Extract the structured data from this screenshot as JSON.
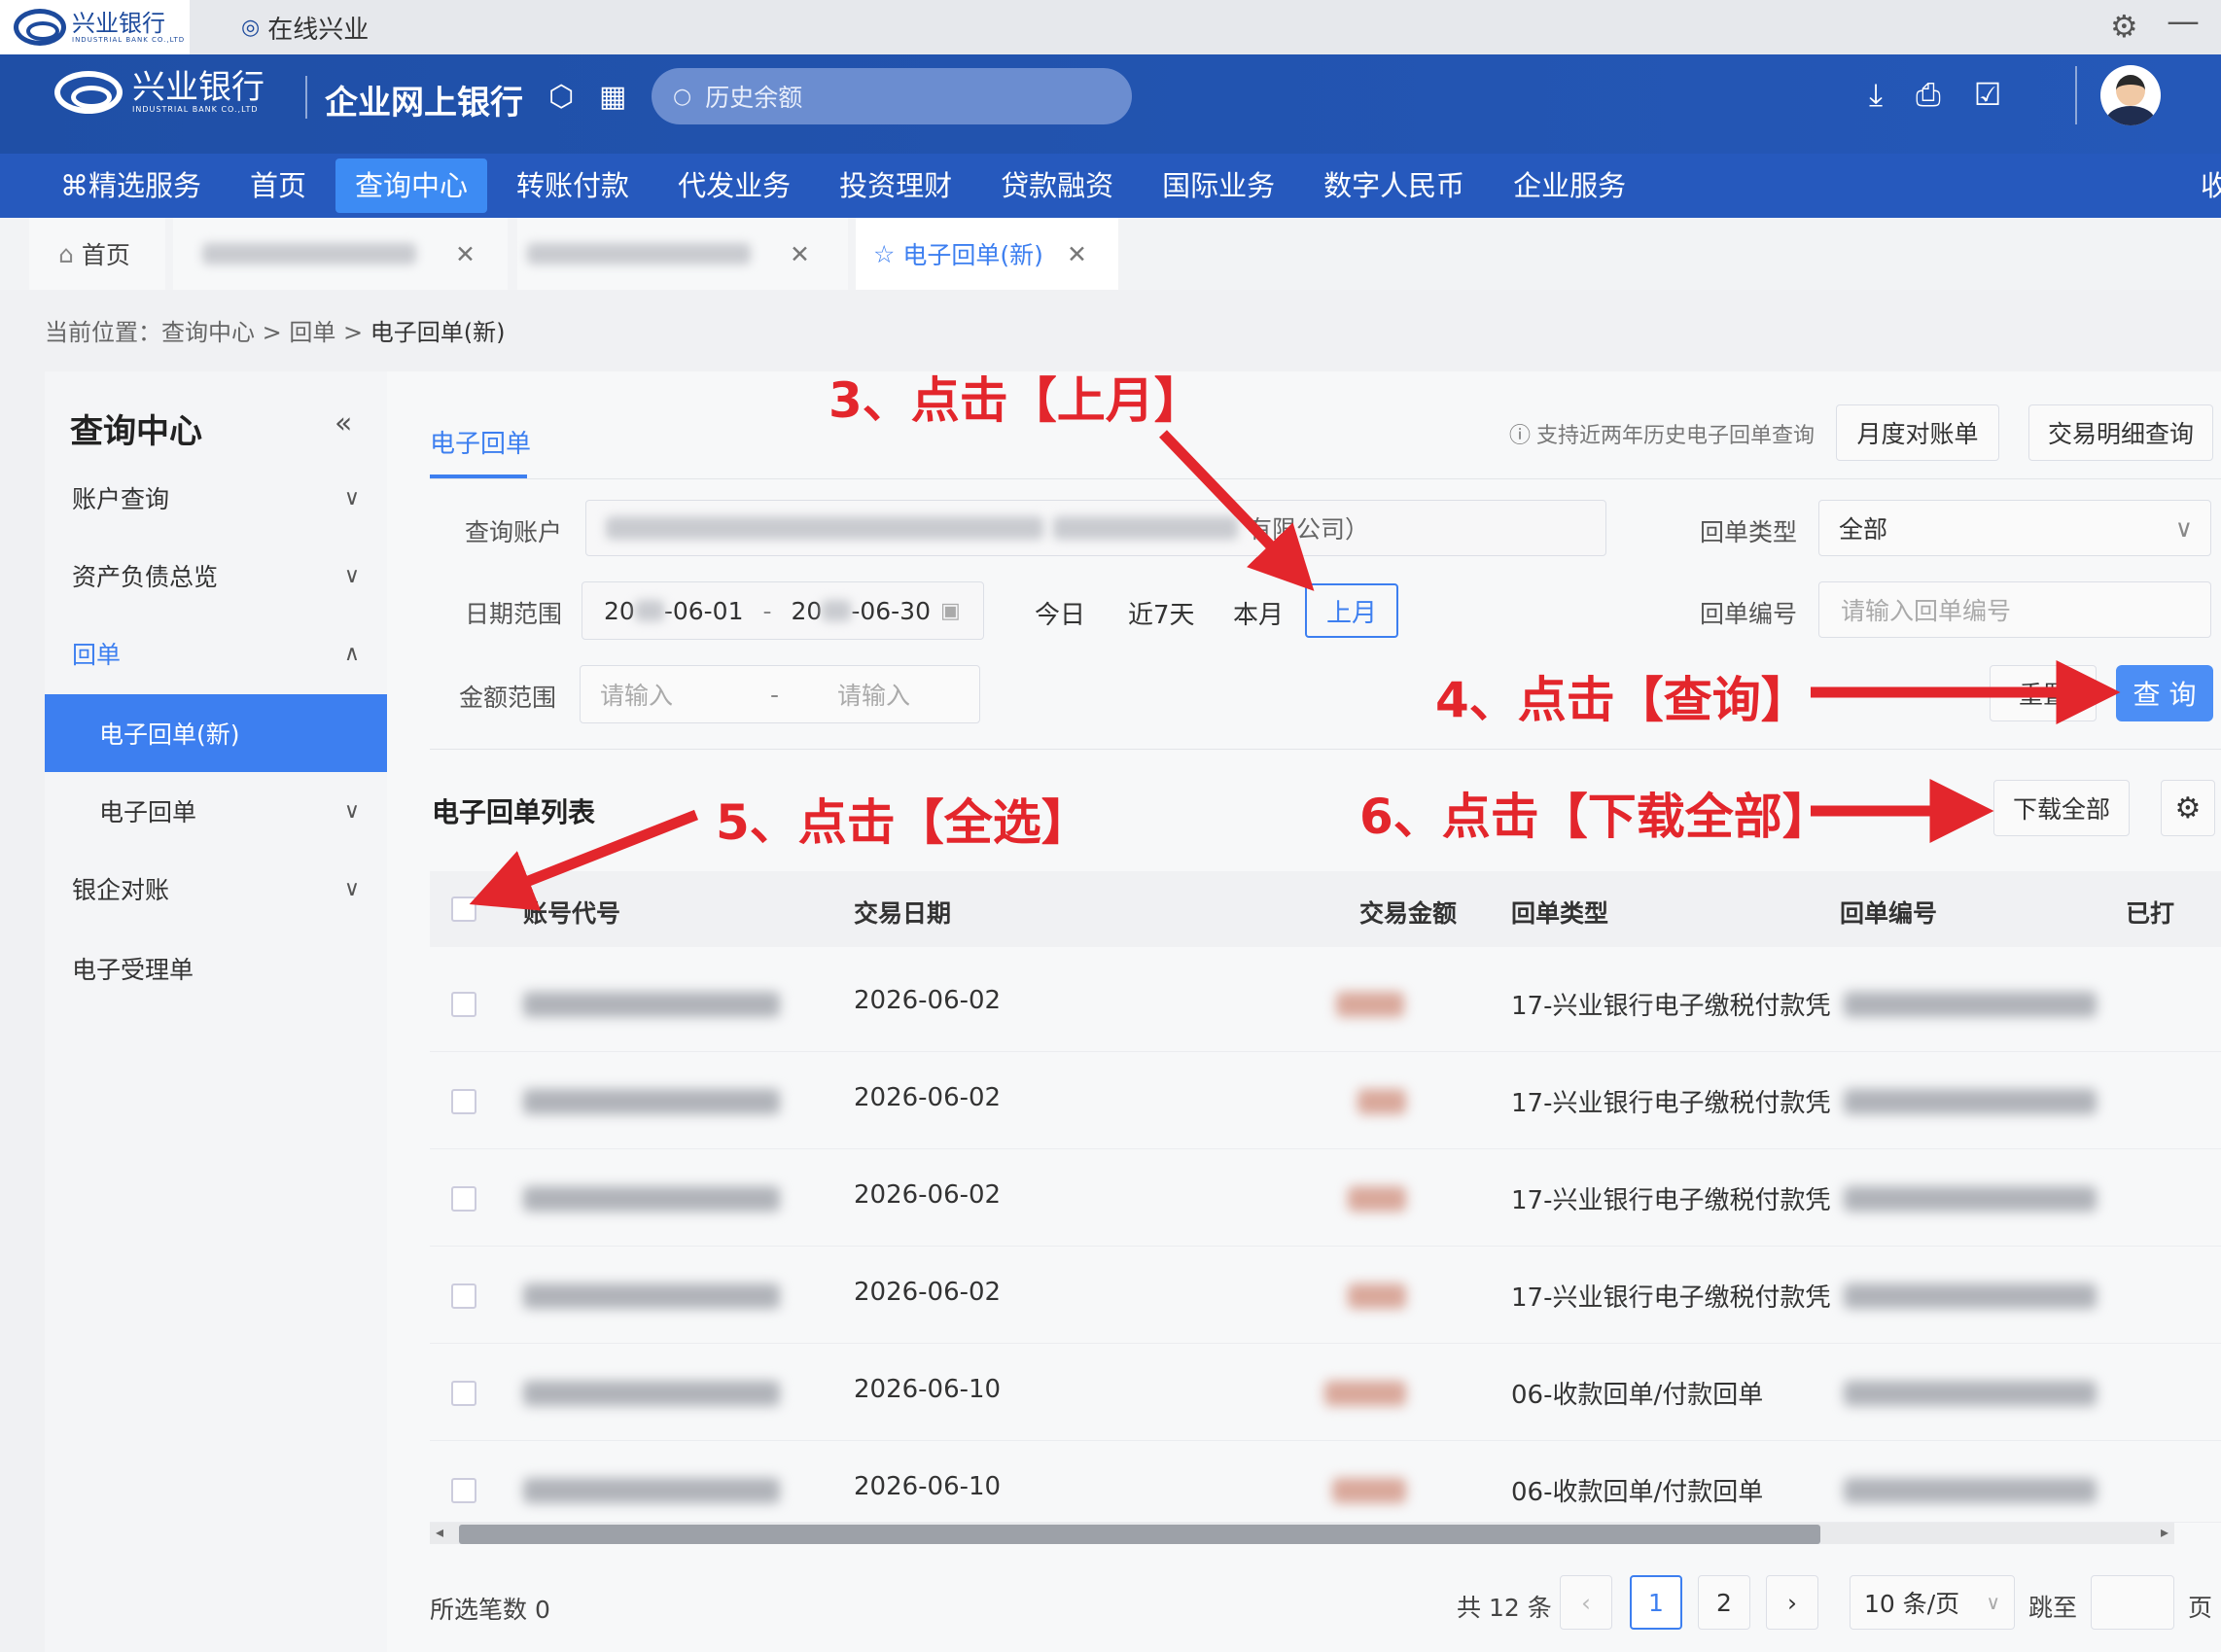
{
  "browser": {
    "bank_logo_text": "兴业银行",
    "tab_title": "在线兴业"
  },
  "header": {
    "bank_name": "兴业银行",
    "bank_name_en": "INDUSTRIAL BANK CO.,LTD",
    "app_title": "企业网上银行",
    "search_placeholder": "历史余额"
  },
  "nav": {
    "items": [
      "精选服务",
      "首页",
      "查询中心",
      "转账付款",
      "代发业务",
      "投资理财",
      "贷款融资",
      "国际业务",
      "数字人民币",
      "企业服务",
      "收"
    ],
    "active_index": 2
  },
  "page_tabs": {
    "home": "首页",
    "current": "电子回单(新)"
  },
  "breadcrumb": {
    "prefix": "当前位置：",
    "path": "查询中心 > 回单 > ",
    "current": "电子回单(新)"
  },
  "sidebar": {
    "title": "查询中心",
    "items": [
      {
        "label": "账户查询"
      },
      {
        "label": "资产负债总览"
      },
      {
        "label": "回单"
      },
      {
        "label": "电子回单(新)"
      },
      {
        "label": "电子回单"
      },
      {
        "label": "银企对账"
      },
      {
        "label": "电子受理单"
      }
    ]
  },
  "main": {
    "tab": "电子回单",
    "notice": "支持近两年历史电子回单查询",
    "btn_monthly": "月度对账单",
    "btn_detail": "交易明细查询"
  },
  "form": {
    "account_label": "查询账户",
    "account_suffix": "有限公司）",
    "type_label": "回单类型",
    "type_value": "全部",
    "date_label": "日期范围",
    "date_start_a": "20",
    "date_start_b": "-06-01",
    "date_sep": "-",
    "date_end_a": "20",
    "date_end_b": "-06-30",
    "today": "今日",
    "last7": "近7天",
    "this_month": "本月",
    "last_month": "上月",
    "no_label": "回单编号",
    "no_placeholder": "请输入回单编号",
    "amount_label": "金额范围",
    "amount_ph1": "请输入",
    "amount_sep": "-",
    "amount_ph2": "请输入",
    "reset": "重置",
    "query": "查 询"
  },
  "list": {
    "title": "电子回单列表",
    "download_all": "下载全部",
    "columns": [
      "账号代号",
      "交易日期",
      "交易金额",
      "回单类型",
      "回单编号",
      "已打"
    ],
    "rows": [
      {
        "date": "2026-06-02",
        "type": "17-兴业银行电子缴税付款凭"
      },
      {
        "date": "2026-06-02",
        "type": "17-兴业银行电子缴税付款凭"
      },
      {
        "date": "2026-06-02",
        "type": "17-兴业银行电子缴税付款凭"
      },
      {
        "date": "2026-06-02",
        "type": "17-兴业银行电子缴税付款凭"
      },
      {
        "date": "2026-06-10",
        "type": "06-收款回单/付款回单"
      },
      {
        "date": "2026-06-10",
        "type": "06-收款回单/付款回单"
      }
    ]
  },
  "footer": {
    "selected": "所选笔数 0",
    "total": "共 12 条",
    "pages": [
      "1",
      "2"
    ],
    "page_size": "10 条/页",
    "jump": "跳至",
    "page_unit": "页"
  },
  "annotations": {
    "step3": "3、点击【上月】",
    "step4": "4、点击【查询】",
    "step5": "5、点击【全选】",
    "step6": "6、点击【下载全部】",
    "arrow_color": "#e3262c"
  },
  "colors": {
    "brand": "#2659bd",
    "accent": "#3d7ff0"
  }
}
